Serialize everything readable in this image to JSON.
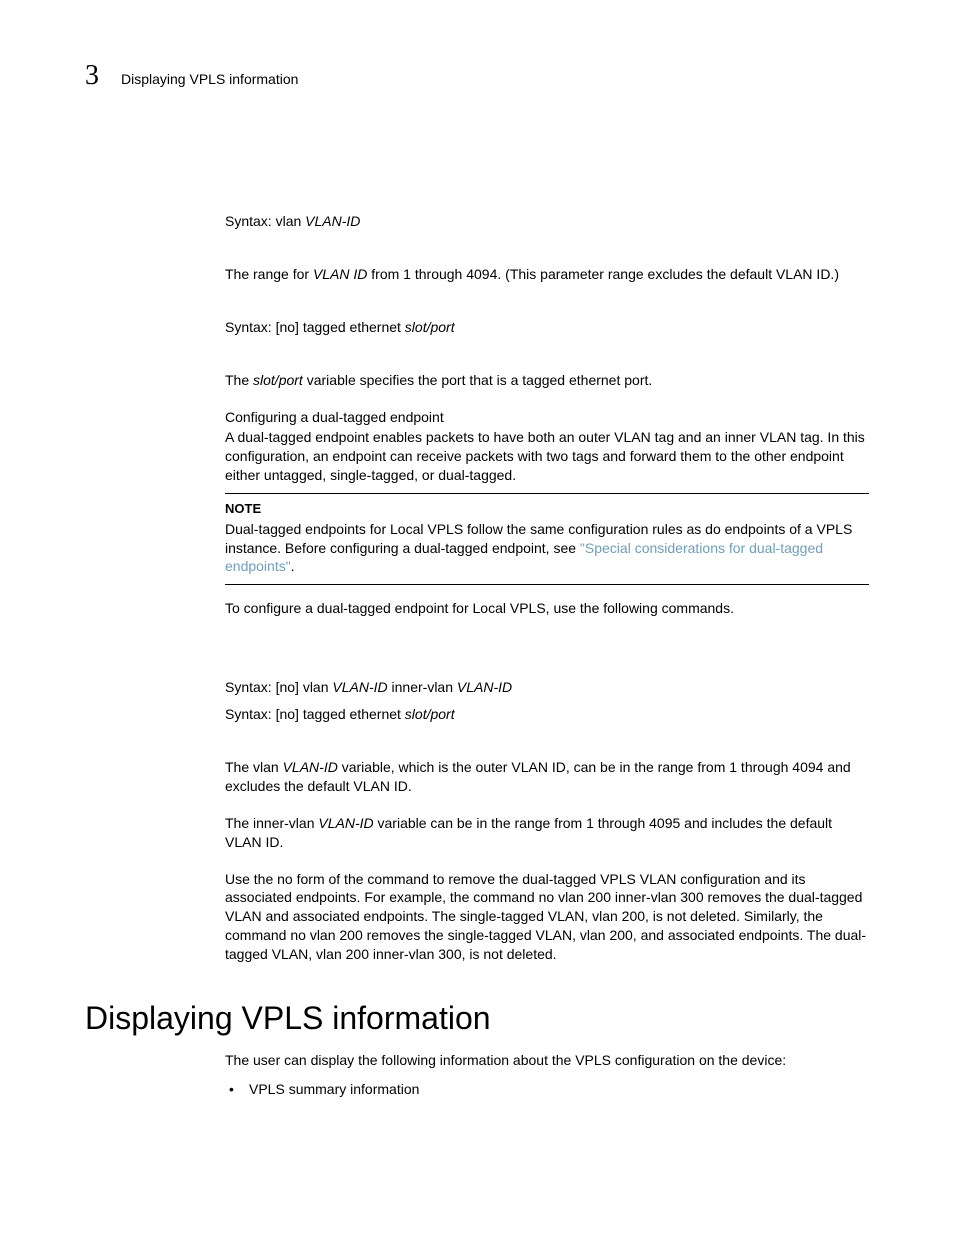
{
  "header": {
    "chapter_number": "3",
    "running_title": "Displaying VPLS information"
  },
  "body": {
    "syntax1_prefix": "Syntax:  vlan ",
    "syntax1_var": "VLAN-ID",
    "para1_a": "The range for ",
    "para1_var": "VLAN ID",
    "para1_b": " from 1 through 4094. (This parameter range excludes the default VLAN ID.)",
    "syntax2_prefix": "Syntax:  [no] tagged ethernet ",
    "syntax2_var": "slot/port",
    "para2_a": "The ",
    "para2_var": "slot/port",
    "para2_b": " variable specifies the port that is a tagged ethernet port.",
    "subhead1": "Configuring a dual-tagged endpoint",
    "para3": "A dual-tagged endpoint enables packets to have both an outer VLAN tag and an inner VLAN tag. In this configuration, an endpoint can receive packets with two tags and forward them to the other endpoint either untagged, single-tagged, or dual-tagged.",
    "note_label": "NOTE",
    "note_text_a": "Dual-tagged endpoints for Local VPLS follow the same configuration rules as do endpoints of a VPLS instance. Before configuring a dual-tagged endpoint, see ",
    "note_link": "\"Special considerations for dual-tagged endpoints\"",
    "note_text_b": ".",
    "para4": "To configure a dual-tagged endpoint for Local VPLS, use the following commands.",
    "syntax3_prefix": "Syntax:  [no] vlan ",
    "syntax3_var1": "VLAN-ID",
    "syntax3_mid": " inner-vlan ",
    "syntax3_var2": "VLAN-ID",
    "syntax4_prefix": "Syntax:  [no] tagged ethernet ",
    "syntax4_var": "slot/port",
    "para5_a": "The vlan ",
    "para5_var": "VLAN-ID",
    "para5_b": " variable, which is the outer VLAN ID, can be in the range from 1 through 4094 and excludes the default VLAN ID.",
    "para6_a": "The inner-vlan ",
    "para6_var": "VLAN-ID",
    "para6_b": " variable can be in the range from 1 through 4095 and includes the default VLAN ID.",
    "para7": "Use the no form of the command to remove the dual-tagged VPLS VLAN configuration and its associated endpoints. For example, the command no vlan 200 inner-vlan 300 removes the dual-tagged VLAN and associated endpoints. The single-tagged VLAN, vlan 200, is not deleted. Similarly, the command no vlan 200 removes the single-tagged VLAN, vlan 200, and associated endpoints. The dual-tagged VLAN, vlan 200 inner-vlan 300, is not deleted.",
    "heading": "Displaying VPLS information",
    "para8": "The user can display the following information about the VPLS configuration on the device:",
    "bullet1": "VPLS summary information"
  }
}
